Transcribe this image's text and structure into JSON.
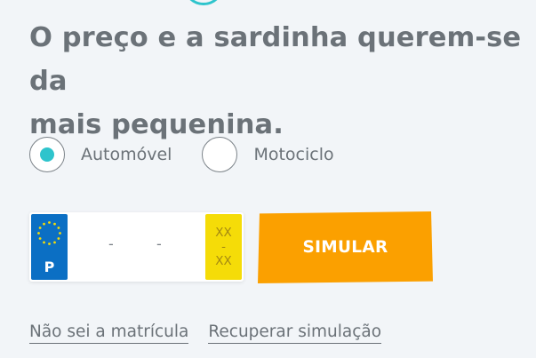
{
  "hero": {
    "title": "O preço e a sardinha querem-se da\nmais pequenina."
  },
  "vehicle_type": {
    "options": [
      {
        "label": "Automóvel",
        "selected": true
      },
      {
        "label": "Motociclo",
        "selected": false
      }
    ]
  },
  "plate": {
    "country_code": "P",
    "separator": "-",
    "year_placeholder_top": "XX",
    "year_placeholder_sep": "-",
    "year_placeholder_bottom": "XX"
  },
  "actions": {
    "simulate_label": "SIMULAR"
  },
  "links": {
    "dont_know_plate": "Não sei a matrícula",
    "recover_simulation": "Recuperar simulação"
  },
  "colors": {
    "accent_teal": "#2ec4cc",
    "button_orange": "#fba000",
    "plate_blue": "#0b6fc4",
    "plate_yellow": "#f5dc08",
    "text_gray": "#6b7278"
  }
}
